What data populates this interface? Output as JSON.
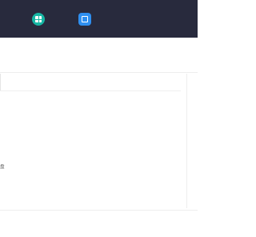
{
  "topbar": {
    "left_edge_label": "",
    "items": [
      {
        "label": "",
        "icon": "windows-icon",
        "color": "#17b6a4"
      },
      {
        "label": "",
        "icon": "disk-icon",
        "color": "#2f8ff0"
      }
    ]
  },
  "notice": {
    "title": "",
    "subtitle": ""
  },
  "panel": {
    "edge_mark": "盘"
  },
  "side": {
    "items": [
      "",
      "",
      "",
      "",
      "",
      ""
    ]
  }
}
